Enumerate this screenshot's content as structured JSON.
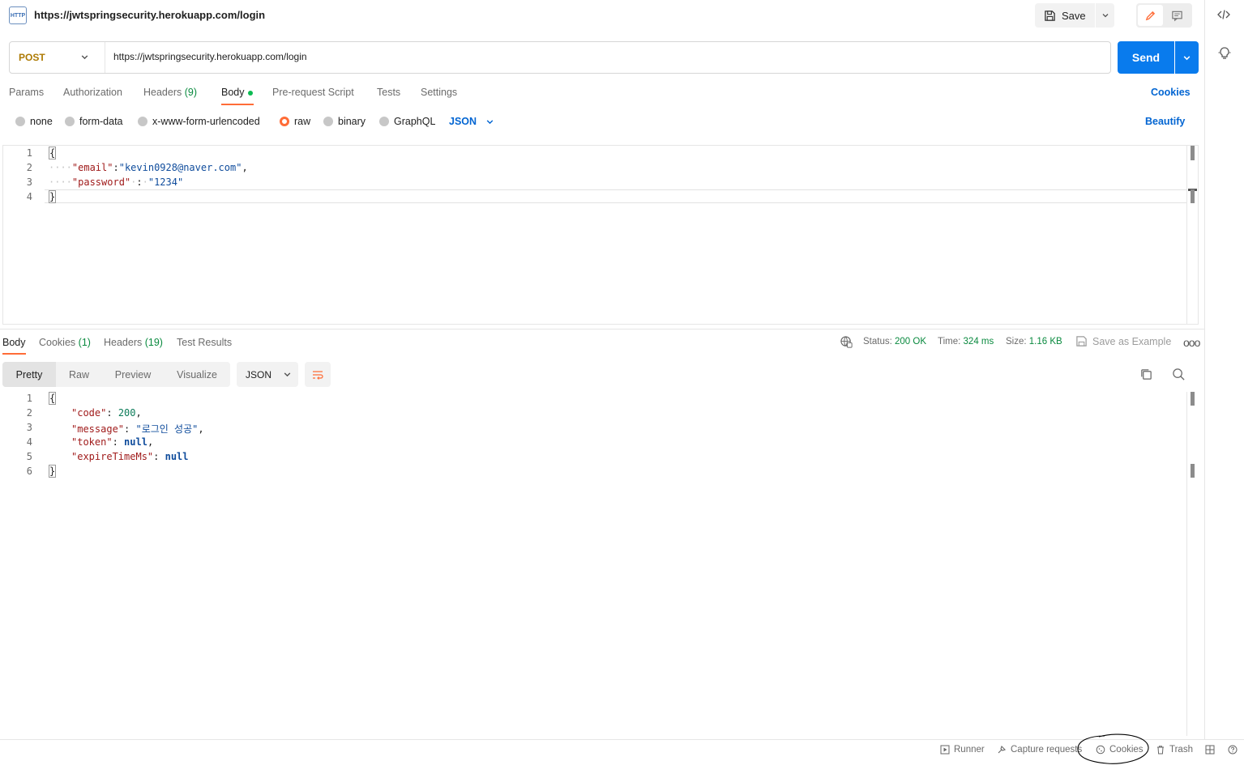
{
  "header": {
    "title": "https://jwtspringsecurity.herokuapp.com/login",
    "http_icon_text": "HTTP",
    "save_label": "Save"
  },
  "request": {
    "method": "POST",
    "url": "https://jwtspringsecurity.herokuapp.com/login",
    "send_label": "Send"
  },
  "tabs": {
    "params": "Params",
    "authorization": "Authorization",
    "headers": "Headers",
    "headers_count": "(9)",
    "body": "Body",
    "pre_request": "Pre-request Script",
    "tests": "Tests",
    "settings": "Settings",
    "cookies": "Cookies"
  },
  "body_types": {
    "none": "none",
    "form_data": "form-data",
    "urlencoded": "x-www-form-urlencoded",
    "raw": "raw",
    "binary": "binary",
    "graphql": "GraphQL",
    "selected_format": "JSON",
    "beautify": "Beautify"
  },
  "request_body": {
    "line_numbers": [
      "1",
      "2",
      "3",
      "4"
    ],
    "open_brace": "{",
    "close_brace": "}",
    "email_key": "\"email\"",
    "email_value": "\"kevin0928@naver.com\"",
    "password_key": "\"password\"",
    "password_value": "\"1234\""
  },
  "response_tabs": {
    "body": "Body",
    "cookies": "Cookies",
    "cookies_count": "(1)",
    "headers": "Headers",
    "headers_count": "(19)",
    "test_results": "Test Results"
  },
  "response_meta": {
    "status_label": "Status:",
    "status_value": "200 OK",
    "time_label": "Time:",
    "time_value": "324 ms",
    "size_label": "Size:",
    "size_value": "1.16 KB",
    "save_example": "Save as Example",
    "more": "ooo"
  },
  "response_view": {
    "pretty": "Pretty",
    "raw": "Raw",
    "preview": "Preview",
    "visualize": "Visualize",
    "format": "JSON"
  },
  "response_body": {
    "line_numbers": [
      "1",
      "2",
      "3",
      "4",
      "5",
      "6"
    ],
    "open_brace": "{",
    "close_brace": "}",
    "code_key": "\"code\"",
    "code_value": "200",
    "message_key": "\"message\"",
    "message_value": "\"로그인 성공\"",
    "token_key": "\"token\"",
    "token_value": "null",
    "expire_key": "\"expireTimeMs\"",
    "expire_value": "null"
  },
  "status_bar": {
    "runner": "Runner",
    "capture": "Capture requests",
    "cookies": "Cookies",
    "trash": "Trash"
  },
  "colors": {
    "accent_orange": "#ff6c37",
    "send_blue": "#097bed",
    "link_blue": "#0265d2",
    "status_green": "#0a8a3f",
    "method_post": "#ad7a03"
  }
}
